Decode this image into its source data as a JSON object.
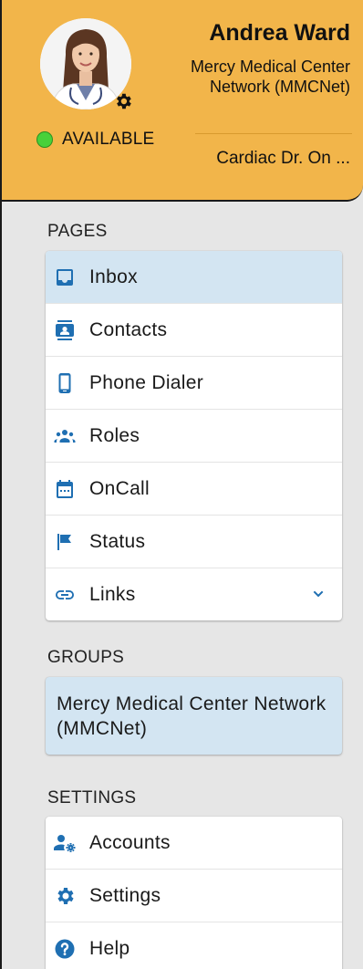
{
  "profile": {
    "name": "Andrea Ward",
    "organization": "Mercy Medical Center Network (MMCNet)",
    "presence": "AVAILABLE",
    "role": "Cardiac Dr. On ..."
  },
  "pages": {
    "heading": "PAGES",
    "items": [
      {
        "label": "Inbox",
        "icon": "inbox-icon",
        "active": true
      },
      {
        "label": "Contacts",
        "icon": "contacts-icon"
      },
      {
        "label": "Phone Dialer",
        "icon": "phone-icon"
      },
      {
        "label": "Roles",
        "icon": "roles-icon"
      },
      {
        "label": "OnCall",
        "icon": "calendar-icon"
      },
      {
        "label": "Status",
        "icon": "flag-icon"
      },
      {
        "label": "Links",
        "icon": "link-icon",
        "expandable": true
      }
    ]
  },
  "groups": {
    "heading": "GROUPS",
    "items": [
      {
        "label": "Mercy Medical Center Network (MMCNet)",
        "selected": true
      }
    ]
  },
  "settings": {
    "heading": "SETTINGS",
    "items": [
      {
        "label": "Accounts",
        "icon": "accounts-icon"
      },
      {
        "label": "Settings",
        "icon": "gear-icon"
      },
      {
        "label": "Help",
        "icon": "help-icon"
      }
    ]
  },
  "colors": {
    "header_bg": "#f2b54a",
    "accent_icon": "#1f6fb2",
    "active_item_bg": "#d3e5f2",
    "presence_green": "#48d13a",
    "sidebar_bg": "#e6e6e6"
  }
}
